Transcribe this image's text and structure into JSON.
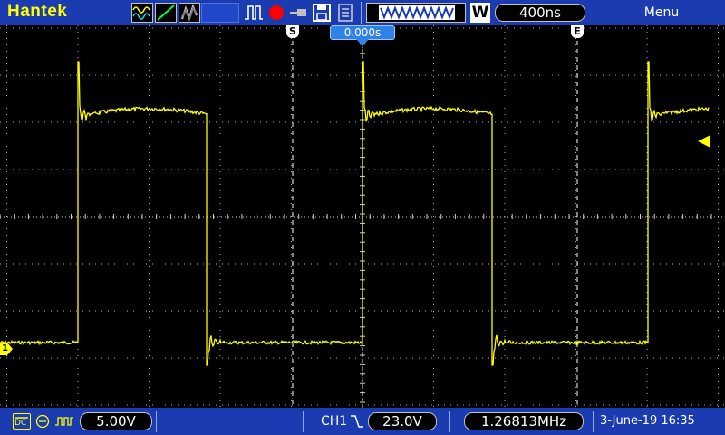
{
  "app": {
    "brand": "Hantek",
    "menu_label": "Menu"
  },
  "toolbar": {
    "timebase": "400ns",
    "trigger_position": "0.000s",
    "cursor_start_marker": "S",
    "cursor_end_marker": "E",
    "mode_label": "W"
  },
  "channel": {
    "marker_label": "1",
    "coupling": "DC",
    "volts_per_div": "5.00V"
  },
  "status": {
    "trigger_source": "CH1",
    "trigger_level": "23.0V",
    "frequency": "1.26813MHz",
    "date_time": "3-June-19 16:35"
  },
  "colors": {
    "toolbar_bg": "#1a3cb0",
    "trace": "#ffff00",
    "grid": "#b0b0b0",
    "trigger_marker": "#2f82e8",
    "record_dot": "#ff0000"
  }
}
